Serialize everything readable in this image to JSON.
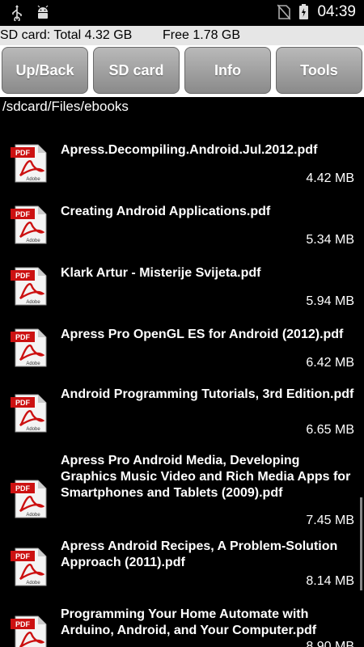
{
  "status_bar": {
    "time": "04:39",
    "left_icons": [
      "usb-icon",
      "android-debug-icon"
    ],
    "right_icons": [
      "no-sim-icon",
      "battery-charging-icon"
    ]
  },
  "storage": {
    "total_label": "SD card: Total 4.32 GB",
    "free_label": "Free 1.78 GB"
  },
  "toolbar": {
    "buttons": [
      "Up/Back",
      "SD card",
      "Info",
      "Tools"
    ]
  },
  "path": "/sdcard/Files/ebooks",
  "files": [
    {
      "name": "Apress.Decompiling.Android.Jul.2012.pdf",
      "size": "4.42 MB",
      "icon": "pdf-adobe-icon"
    },
    {
      "name": "Creating Android Applications.pdf",
      "size": "5.34 MB",
      "icon": "pdf-adobe-icon"
    },
    {
      "name": "Klark Artur  - Misterije Svijeta.pdf",
      "size": "5.94 MB",
      "icon": "pdf-adobe-icon"
    },
    {
      "name": "Apress Pro OpenGL ES for Android (2012).pdf",
      "size": "6.42 MB",
      "icon": "pdf-adobe-icon"
    },
    {
      "name": "Android Programming Tutorials, 3rd Edition.pdf",
      "size": "6.65 MB",
      "icon": "pdf-adobe-icon"
    },
    {
      "name": "Apress Pro Android Media, Developing Graphics Music Video and Rich Media Apps for Smartphones and Tablets (2009).pdf",
      "size": "7.45 MB",
      "icon": "pdf-adobe-icon"
    },
    {
      "name": "Apress Android Recipes, A Problem-Solution Approach (2011).pdf",
      "size": "8.14 MB",
      "icon": "pdf-adobe-icon"
    },
    {
      "name": "Programming Your Home Automate with Arduino, Android, and Your Computer.pdf",
      "size": "8.90 MB",
      "icon": "pdf-adobe-icon"
    }
  ],
  "colors": {
    "background": "#000000",
    "storage_bar": "#e6e6e6",
    "button_top": "#b9b9b9",
    "button_bottom": "#8a8a8a",
    "pdf_red": "#cc1111"
  }
}
